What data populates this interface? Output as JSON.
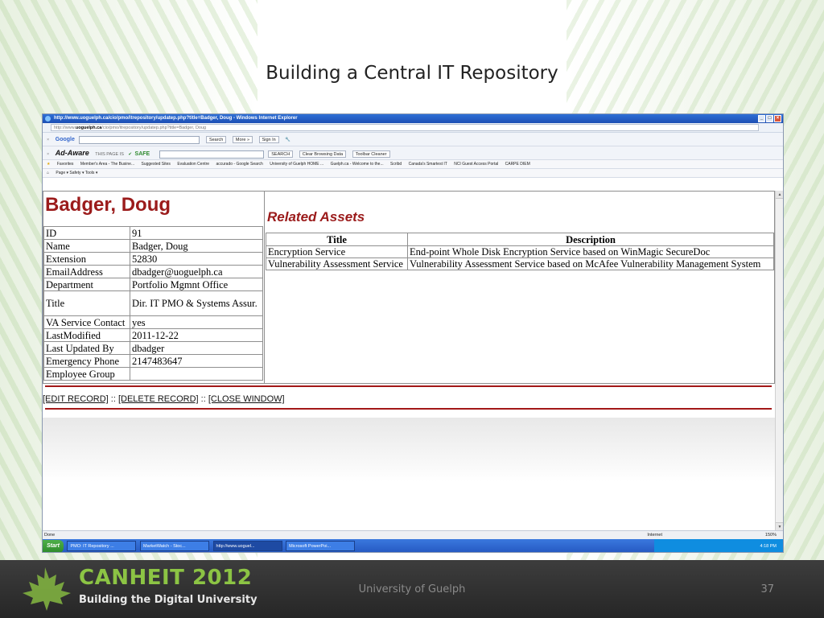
{
  "slide": {
    "title": "Building a Central IT Repository",
    "footer": {
      "brand": "CANHEIT 2012",
      "tagline": "Building the Digital University",
      "organization": "University of Guelph",
      "page_number": "37"
    }
  },
  "browser": {
    "window_title": "http://www.uoguelph.ca/cio/pmo/itrepository/updatep.php?title=Badger, Doug - Windows Internet Explorer",
    "address_host": "uoguelph.ca",
    "address_rest": "/cio/pmo/itrepository/updatep.php?title=Badger, Doug",
    "google_label": "Google",
    "search_label": "Search",
    "more_label": "More »",
    "signin_label": "Sign In",
    "adaware_label": "Ad-Aware",
    "this_page_is": "THIS PAGE IS",
    "safe_label": "SAFE",
    "search_btn": "SEARCH",
    "clear_browsing": "Clear Browsing Data",
    "toolbar_cleaner": "Toolbar Cleaner",
    "favorites": [
      "Favorites",
      "Member's Area - The Busine...",
      "Suggested Sites",
      "Evaluation Centre",
      "accurado - Google Search",
      "University of Guelph HOME ...",
      "Guelph.ca - Welcome to the...",
      "Scribd",
      "Canada's Smartest IT",
      "NCI Guest Access Portal",
      "CARPE DIEM"
    ],
    "command_bar": "Page ▾   Safety ▾   Tools ▾",
    "status_left": "Done",
    "status_zone": "Internet",
    "status_zoom": "150%",
    "start_label": "Start",
    "tasks": [
      "PMO: IT Repository ...",
      "MarketWatch - Stoc...",
      "http://www.uoguel...",
      "Microsoft PowerPoi..."
    ],
    "clock": "4:18 PM"
  },
  "record": {
    "name": "Badger, Doug",
    "fields": [
      {
        "key": "ID",
        "value": "91"
      },
      {
        "key": "Name",
        "value": "Badger, Doug"
      },
      {
        "key": "Extension",
        "value": "52830"
      },
      {
        "key": "EmailAddress",
        "value": "dbadger@uoguelph.ca"
      },
      {
        "key": "Department",
        "value": "Portfolio Mgmnt Office"
      },
      {
        "key": "Title",
        "value": "Dir. IT PMO & Systems Assur."
      },
      {
        "key": "VA Service Contact",
        "value": "yes"
      },
      {
        "key": "LastModified",
        "value": "2011-12-22"
      },
      {
        "key": "Last Updated By",
        "value": "dbadger"
      },
      {
        "key": "Emergency Phone",
        "value": "2147483647"
      },
      {
        "key": "Employee Group",
        "value": ""
      }
    ]
  },
  "related": {
    "heading": "Related Assets",
    "columns": [
      "Title",
      "Description"
    ],
    "rows": [
      {
        "title": "Encryption Service",
        "description": "End-point Whole Disk Encryption Service based on WinMagic SecureDoc"
      },
      {
        "title": "Vulnerability Assessment Service",
        "description": "Vulnerability Assessment Service based on McAfee Vulnerability Management System"
      }
    ]
  },
  "actions": {
    "edit": "[EDIT RECORD]",
    "delete": "[DELETE RECORD]",
    "close": "[CLOSE WINDOW]",
    "sep": "::"
  }
}
